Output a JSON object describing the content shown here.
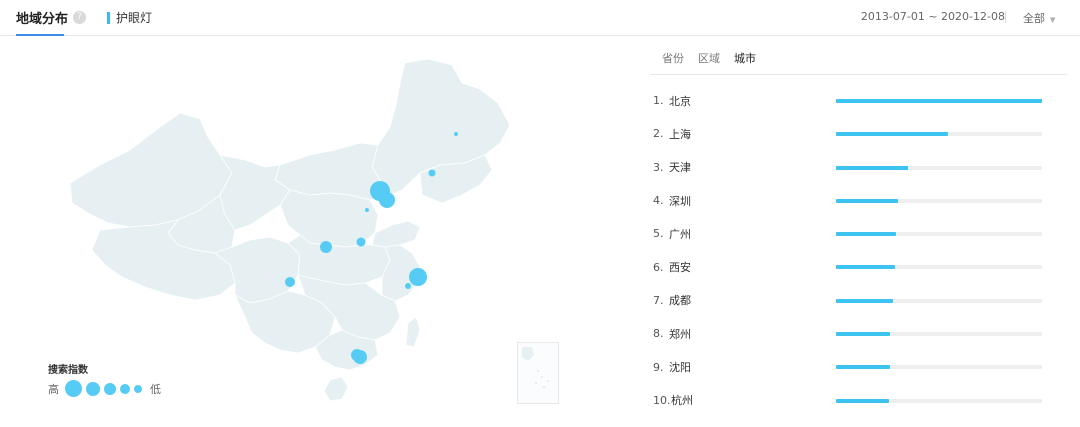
{
  "header": {
    "tab_label": "地域分布",
    "help_icon_text": "?",
    "keyword": "护眼灯",
    "date_range": "2013-07-01 ~ 2020-12-08",
    "region_select": "全部"
  },
  "legend": {
    "title": "搜索指数",
    "high": "高",
    "low": "低"
  },
  "subtabs": [
    "省份",
    "区域",
    "城市"
  ],
  "ranking": [
    {
      "rank": "1.",
      "name": "北京",
      "value": 1.0
    },
    {
      "rank": "2.",
      "name": "上海",
      "value": 0.545
    },
    {
      "rank": "3.",
      "name": "天津",
      "value": 0.35
    },
    {
      "rank": "4.",
      "name": "深圳",
      "value": 0.3
    },
    {
      "rank": "5.",
      "name": "广州",
      "value": 0.29
    },
    {
      "rank": "6.",
      "name": "西安",
      "value": 0.285
    },
    {
      "rank": "7.",
      "name": "成都",
      "value": 0.275
    },
    {
      "rank": "8.",
      "name": "郑州",
      "value": 0.26
    },
    {
      "rank": "9.",
      "name": "沈阳",
      "value": 0.26
    },
    {
      "rank": "10.",
      "name": "杭州",
      "value": 0.255
    }
  ],
  "colors": {
    "accent": "#3cc3f0",
    "map_fill": "#e6f0f3",
    "dot": "#56ccf5"
  }
}
